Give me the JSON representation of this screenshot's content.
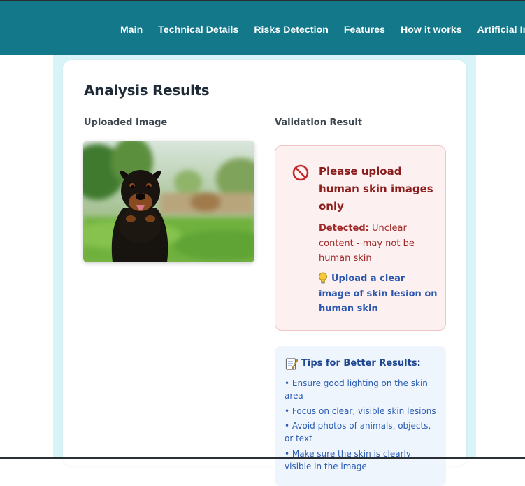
{
  "nav": {
    "items": [
      "Main",
      "Technical Details",
      "Risks Detection",
      "Features",
      "How it works",
      "Artificial Intelligence"
    ]
  },
  "results": {
    "title": "Analysis Results",
    "uploaded_label": "Uploaded Image",
    "validation_label": "Validation Result"
  },
  "validation": {
    "heading": "Please upload human skin images only",
    "detected_label": "Detected:",
    "detected_text": " Unclear content - may not be human skin",
    "tip": "Upload a clear image of skin lesion on human skin"
  },
  "tips": {
    "title": "Tips for Better Results:",
    "items": [
      "• Ensure good lighting on the skin area",
      "• Focus on clear, visible skin lesions",
      "• Avoid photos of animals, objects, or text",
      "• Make sure the skin is clearly visible in the image"
    ]
  },
  "colors": {
    "header": "#12788a",
    "error_bg": "#fdf0f0",
    "error_text": "#8c1d1d",
    "tip_link": "#2c57b0",
    "tips_bg": "#eef5fd"
  },
  "icons": {
    "validation": "no-entry-icon",
    "tip": "lightbulb-icon",
    "tips": "memo-icon"
  }
}
